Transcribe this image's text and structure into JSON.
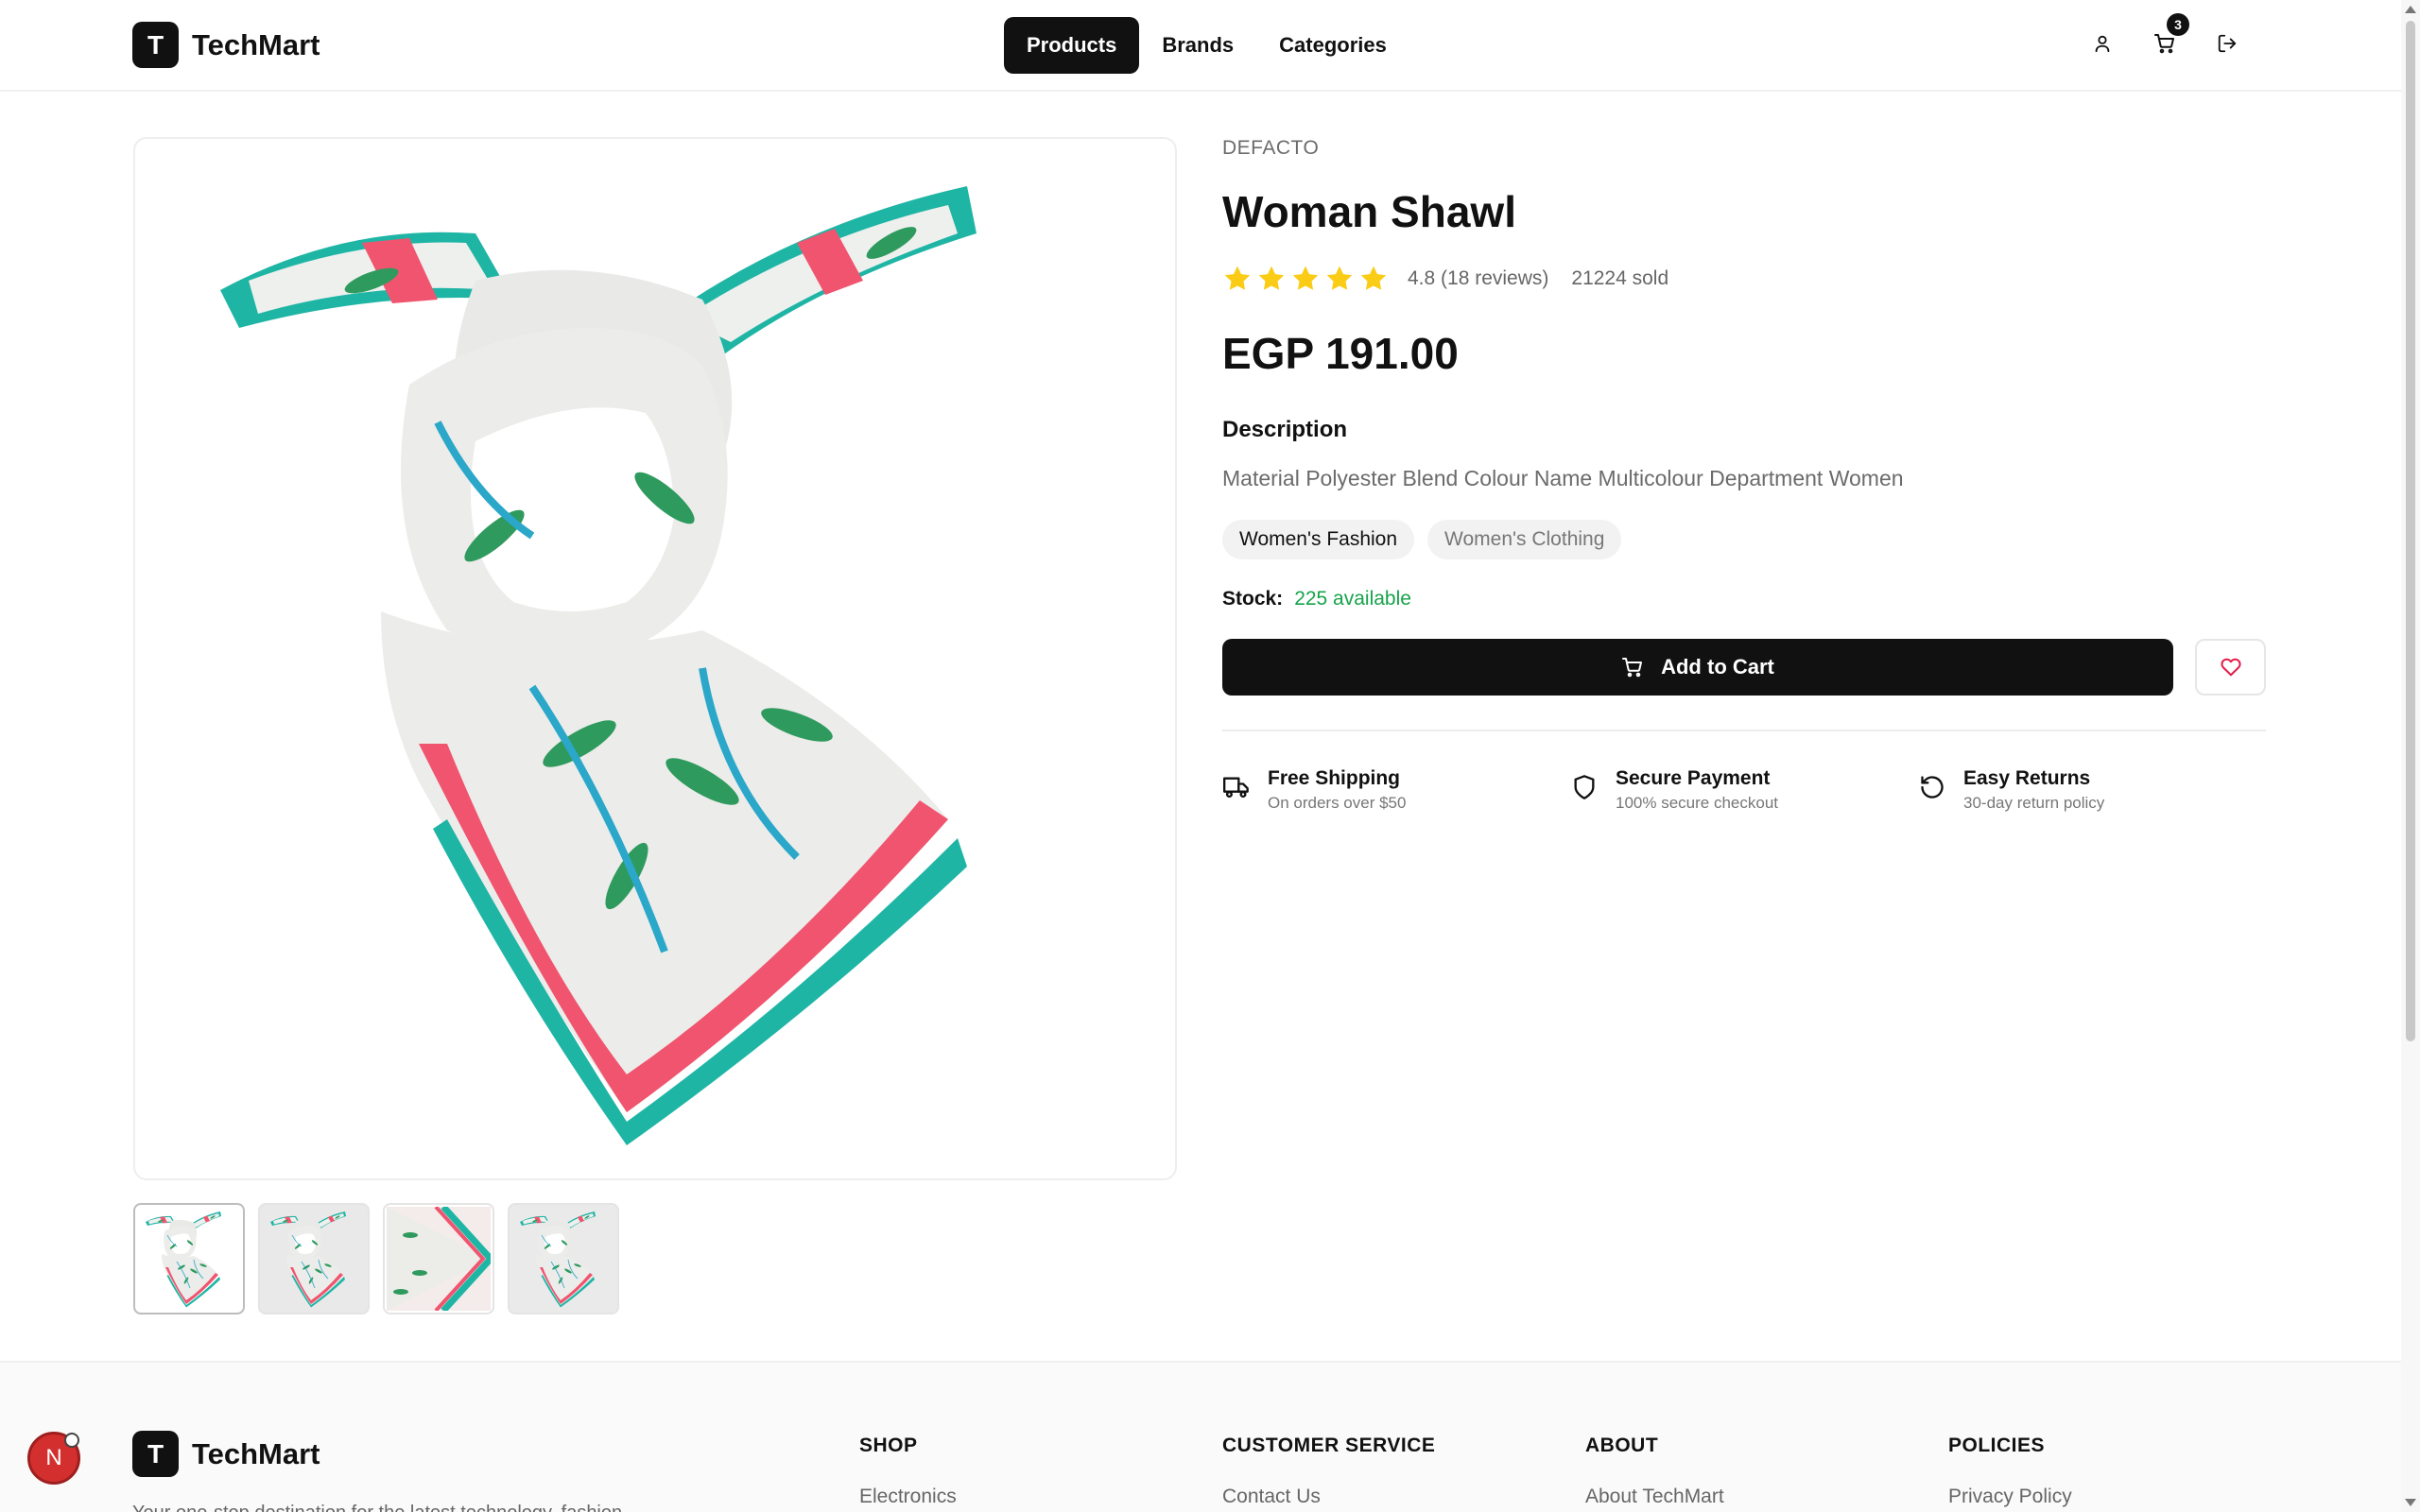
{
  "navbar": {
    "logo_letter": "T",
    "logo_text": "TechMart",
    "links": [
      {
        "label": "Products",
        "active": true
      },
      {
        "label": "Brands",
        "active": false
      },
      {
        "label": "Categories",
        "active": false
      }
    ],
    "cart_count": "3",
    "icons": [
      "user-icon",
      "cart-icon",
      "logout-icon"
    ]
  },
  "product": {
    "brand": "DEFACTO",
    "title": "Woman Shawl",
    "rating_text": "4.8 (18 reviews)",
    "rating_value": 4.8,
    "stars_total": 5,
    "sold_text": "21224 sold",
    "price": "EGP 191.00",
    "description_title": "Description",
    "description": "Material Polyester Blend Colour Name Multicolour Department Women",
    "tags": [
      "Women's Fashion",
      "Women's Clothing"
    ],
    "stock_label": "Stock:",
    "stock_value": "225 available",
    "add_to_cart_label": "Add to Cart",
    "thumbnail_count": 4
  },
  "features": [
    {
      "icon": "truck-icon",
      "title": "Free Shipping",
      "subtitle": "On orders over $50"
    },
    {
      "icon": "shield-icon",
      "title": "Secure Payment",
      "subtitle": "100% secure checkout"
    },
    {
      "icon": "rotate-ccw-icon",
      "title": "Easy Returns",
      "subtitle": "30-day return policy"
    }
  ],
  "footer": {
    "logo_letter": "T",
    "logo_text": "TechMart",
    "tagline": "Your one-stop destination for the latest technology, fashion",
    "columns": [
      {
        "title": "SHOP",
        "first_link": "Electronics"
      },
      {
        "title": "CUSTOMER SERVICE",
        "first_link": "Contact Us"
      },
      {
        "title": "ABOUT",
        "first_link": "About TechMart"
      },
      {
        "title": "POLICIES",
        "first_link": "Privacy Policy"
      }
    ]
  },
  "floating_avatar": {
    "letter": "N"
  },
  "colors": {
    "accent": "#111111",
    "star": "#facc15",
    "stock_green": "#16a34a",
    "heart_red": "#e11d48",
    "shawl_teal": "#1fb5a5",
    "shawl_pink": "#f0546e"
  }
}
